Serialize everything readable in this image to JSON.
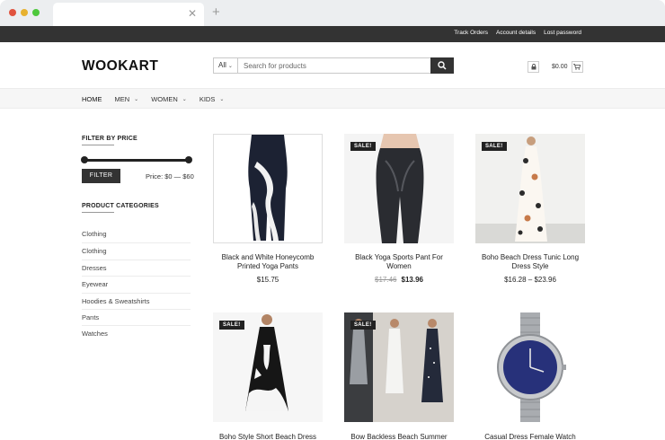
{
  "browser": {
    "close_glyph": "✕",
    "new_tab_glyph": "+"
  },
  "topbar": {
    "links": [
      "Track Orders",
      "Account details",
      "Lost password"
    ]
  },
  "header": {
    "logo": "WOOKART",
    "search": {
      "category": "All",
      "placeholder": "Search for products"
    },
    "cart_total": "$0.00"
  },
  "nav": {
    "items": [
      {
        "label": "HOME",
        "dropdown": false
      },
      {
        "label": "MEN",
        "dropdown": true
      },
      {
        "label": "WOMEN",
        "dropdown": true
      },
      {
        "label": "KIDS",
        "dropdown": true
      }
    ],
    "chevron": "⌄"
  },
  "sidebar": {
    "filter_title": "FILTER BY PRICE",
    "filter_button": "FILTER",
    "price_range": "Price: $0 — $60",
    "categories_title": "PRODUCT CATEGORIES",
    "categories": [
      "Clothing",
      "Clothing",
      "Dresses",
      "Eyewear",
      "Hoodies & Sweatshirts",
      "Pants",
      "Watches"
    ]
  },
  "products": [
    {
      "name": "Black and White Honeycomb Printed Yoga Pants",
      "price": "$15.75",
      "sale": false
    },
    {
      "name": "Black Yoga Sports Pant For Women",
      "old_price": "$17.46",
      "price": "$13.96",
      "sale": true,
      "sale_label": "SALE!"
    },
    {
      "name": "Boho Beach Dress Tunic Long Dress Style",
      "price": "$16.28 – $23.96",
      "sale": true,
      "sale_label": "SALE!"
    },
    {
      "name": "Boho Style Short Beach Dress",
      "sale": true,
      "sale_label": "SALE!"
    },
    {
      "name": "Bow Backless Beach Summer",
      "sale": true,
      "sale_label": "SALE!"
    },
    {
      "name": "Casual Dress Female Watch",
      "sale": false
    }
  ],
  "colors": {
    "topbar": "#333333",
    "accent": "#222222",
    "nav_bg": "#f6f6f6"
  }
}
